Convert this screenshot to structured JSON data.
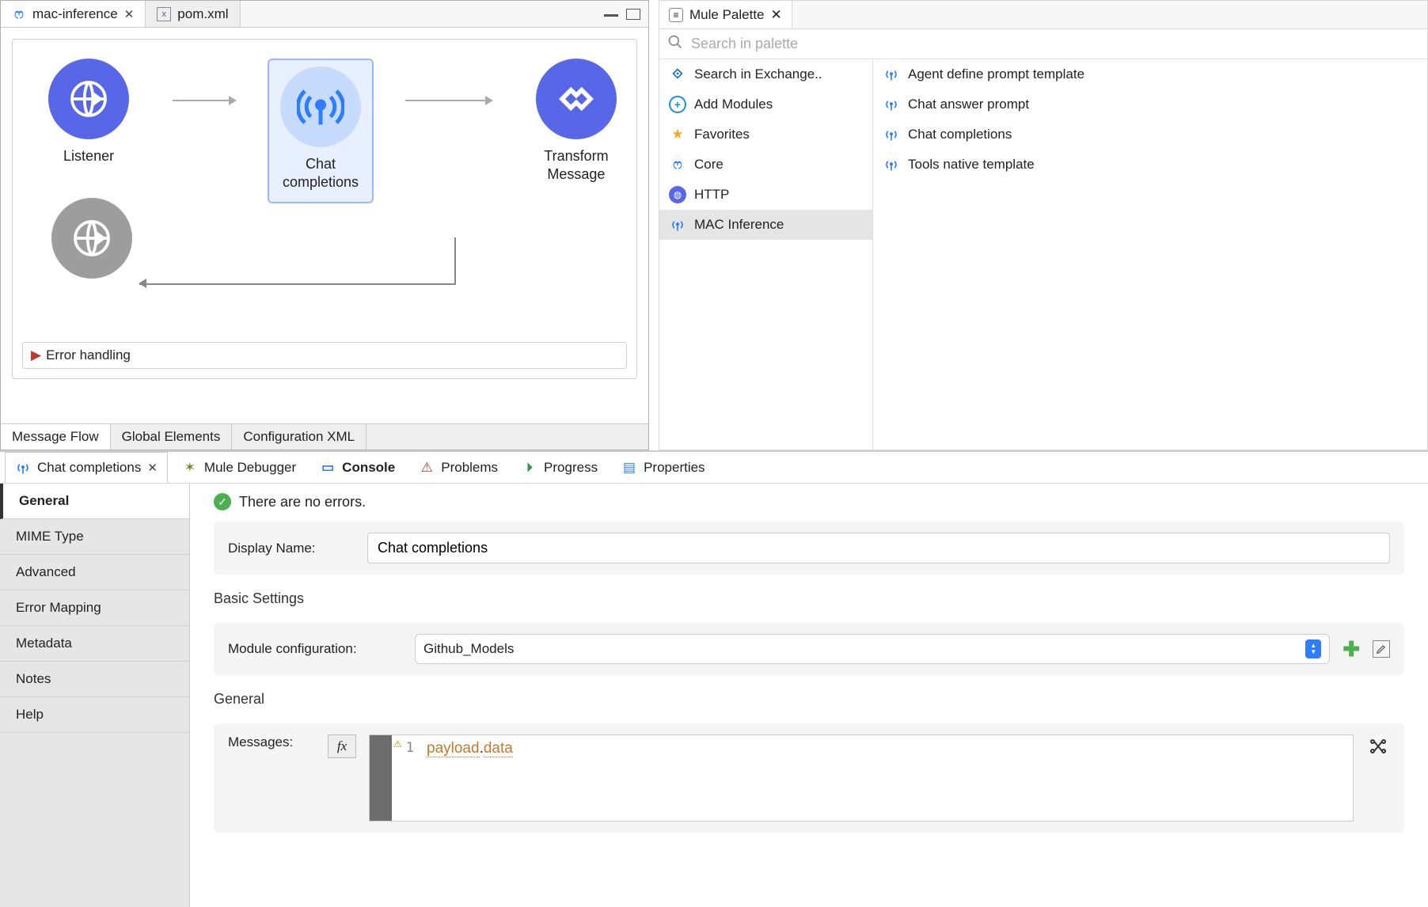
{
  "editor": {
    "tabs": [
      {
        "label": "mac-inference",
        "closable": true
      },
      {
        "label": "pom.xml",
        "closable": false
      }
    ],
    "bottom_tabs": [
      "Message Flow",
      "Global Elements",
      "Configuration XML"
    ],
    "active_bottom_tab": "Message Flow"
  },
  "flow": {
    "nodes": {
      "listener": "Listener",
      "chat_completions": "Chat completions",
      "transform": "Transform Message"
    },
    "error_section": "Error handling"
  },
  "palette": {
    "title": "Mule Palette",
    "search_placeholder": "Search in palette",
    "left": [
      {
        "key": "exchange",
        "label": "Search in Exchange.."
      },
      {
        "key": "add",
        "label": "Add Modules"
      },
      {
        "key": "favorites",
        "label": "Favorites"
      },
      {
        "key": "core",
        "label": "Core"
      },
      {
        "key": "http",
        "label": "HTTP"
      },
      {
        "key": "mac",
        "label": "MAC Inference",
        "selected": true
      }
    ],
    "right": [
      "Agent define prompt template",
      "Chat answer prompt",
      "Chat completions",
      "Tools native template"
    ]
  },
  "bottom_tabs": {
    "active": "Chat completions",
    "items": [
      {
        "key": "chat",
        "label": "Chat completions",
        "closable": true,
        "bold": false
      },
      {
        "key": "debugger",
        "label": "Mule Debugger"
      },
      {
        "key": "console",
        "label": "Console",
        "bold": true
      },
      {
        "key": "problems",
        "label": "Problems"
      },
      {
        "key": "progress",
        "label": "Progress"
      },
      {
        "key": "properties",
        "label": "Properties"
      }
    ]
  },
  "properties": {
    "sidebar": [
      "General",
      "MIME Type",
      "Advanced",
      "Error Mapping",
      "Metadata",
      "Notes",
      "Help"
    ],
    "active_sidebar": "General",
    "status": "There are no errors.",
    "display_name_label": "Display Name:",
    "display_name_value": "Chat completions",
    "basic_settings_title": "Basic Settings",
    "module_config_label": "Module configuration:",
    "module_config_value": "Github_Models",
    "general_title": "General",
    "messages_label": "Messages:",
    "expression_line": "1",
    "expression_payload": "payload",
    "expression_data": "data"
  }
}
